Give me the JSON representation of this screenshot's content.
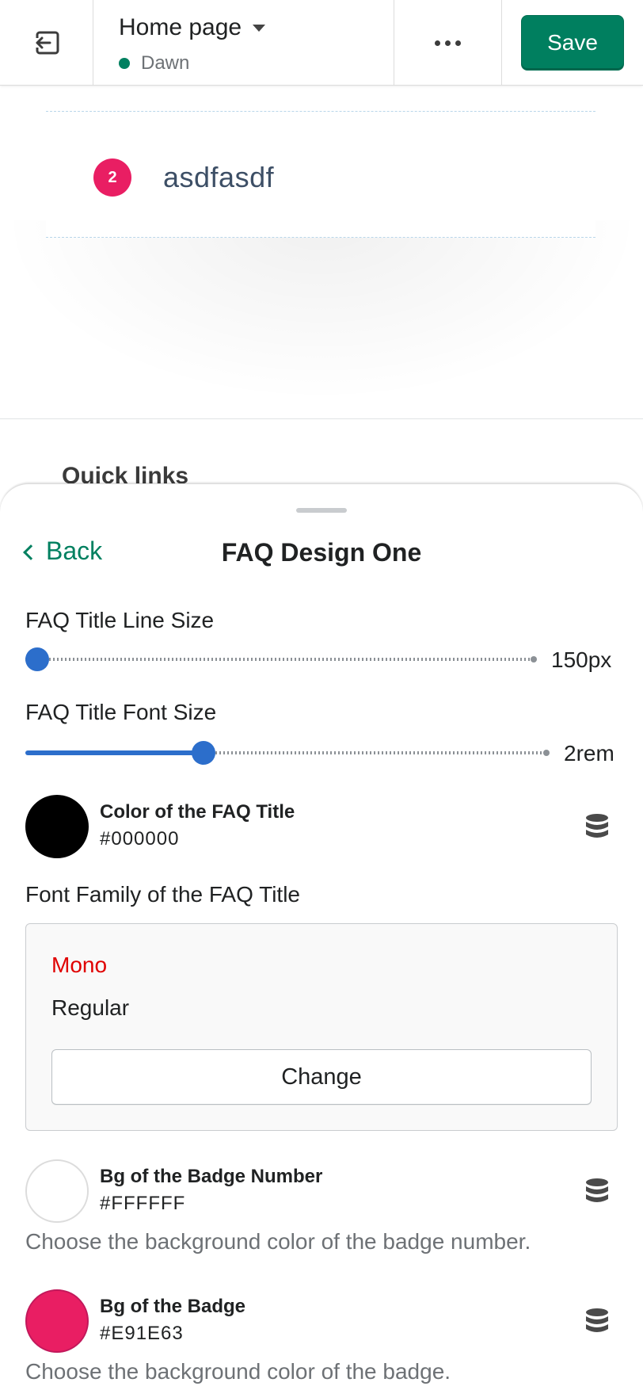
{
  "topbar": {
    "page_title": "Home page",
    "theme_name": "Dawn",
    "save_label": "Save",
    "icons": {
      "exit": "exit-icon",
      "caret": "caret-down-icon",
      "more": "more-horizontal-icon"
    }
  },
  "preview": {
    "faq_item": {
      "badge_number": "2",
      "question": "asdfasdf"
    },
    "next_section_title": "Quick links"
  },
  "sheet": {
    "back_label": "Back",
    "title": "FAQ Design One",
    "title_line_size": {
      "label": "FAQ Title Line Size",
      "value_text": "150px",
      "fraction": 0.0
    },
    "title_font_size": {
      "label": "FAQ Title Font Size",
      "value_text": "2rem",
      "fraction": 0.34
    },
    "title_color": {
      "name": "Color of the FAQ Title",
      "hex": "#000000",
      "swatch": "#000000"
    },
    "font_family": {
      "label": "Font Family of the FAQ Title",
      "font_name": "Mono",
      "font_style": "Regular",
      "change_label": "Change"
    },
    "badge_number_bg": {
      "name": "Bg of the Badge Number",
      "hex": "#FFFFFF",
      "swatch": "#FFFFFF",
      "help": "Choose the background color of the badge number."
    },
    "badge_bg": {
      "name": "Bg of the Badge",
      "hex": "#E91E63",
      "swatch": "#E91E63",
      "help": "Choose the background color of the badge."
    }
  },
  "colors": {
    "accent": "#008060",
    "slider": "#2c6ecb",
    "badge": "#e91e63",
    "error_text": "#e00000"
  }
}
